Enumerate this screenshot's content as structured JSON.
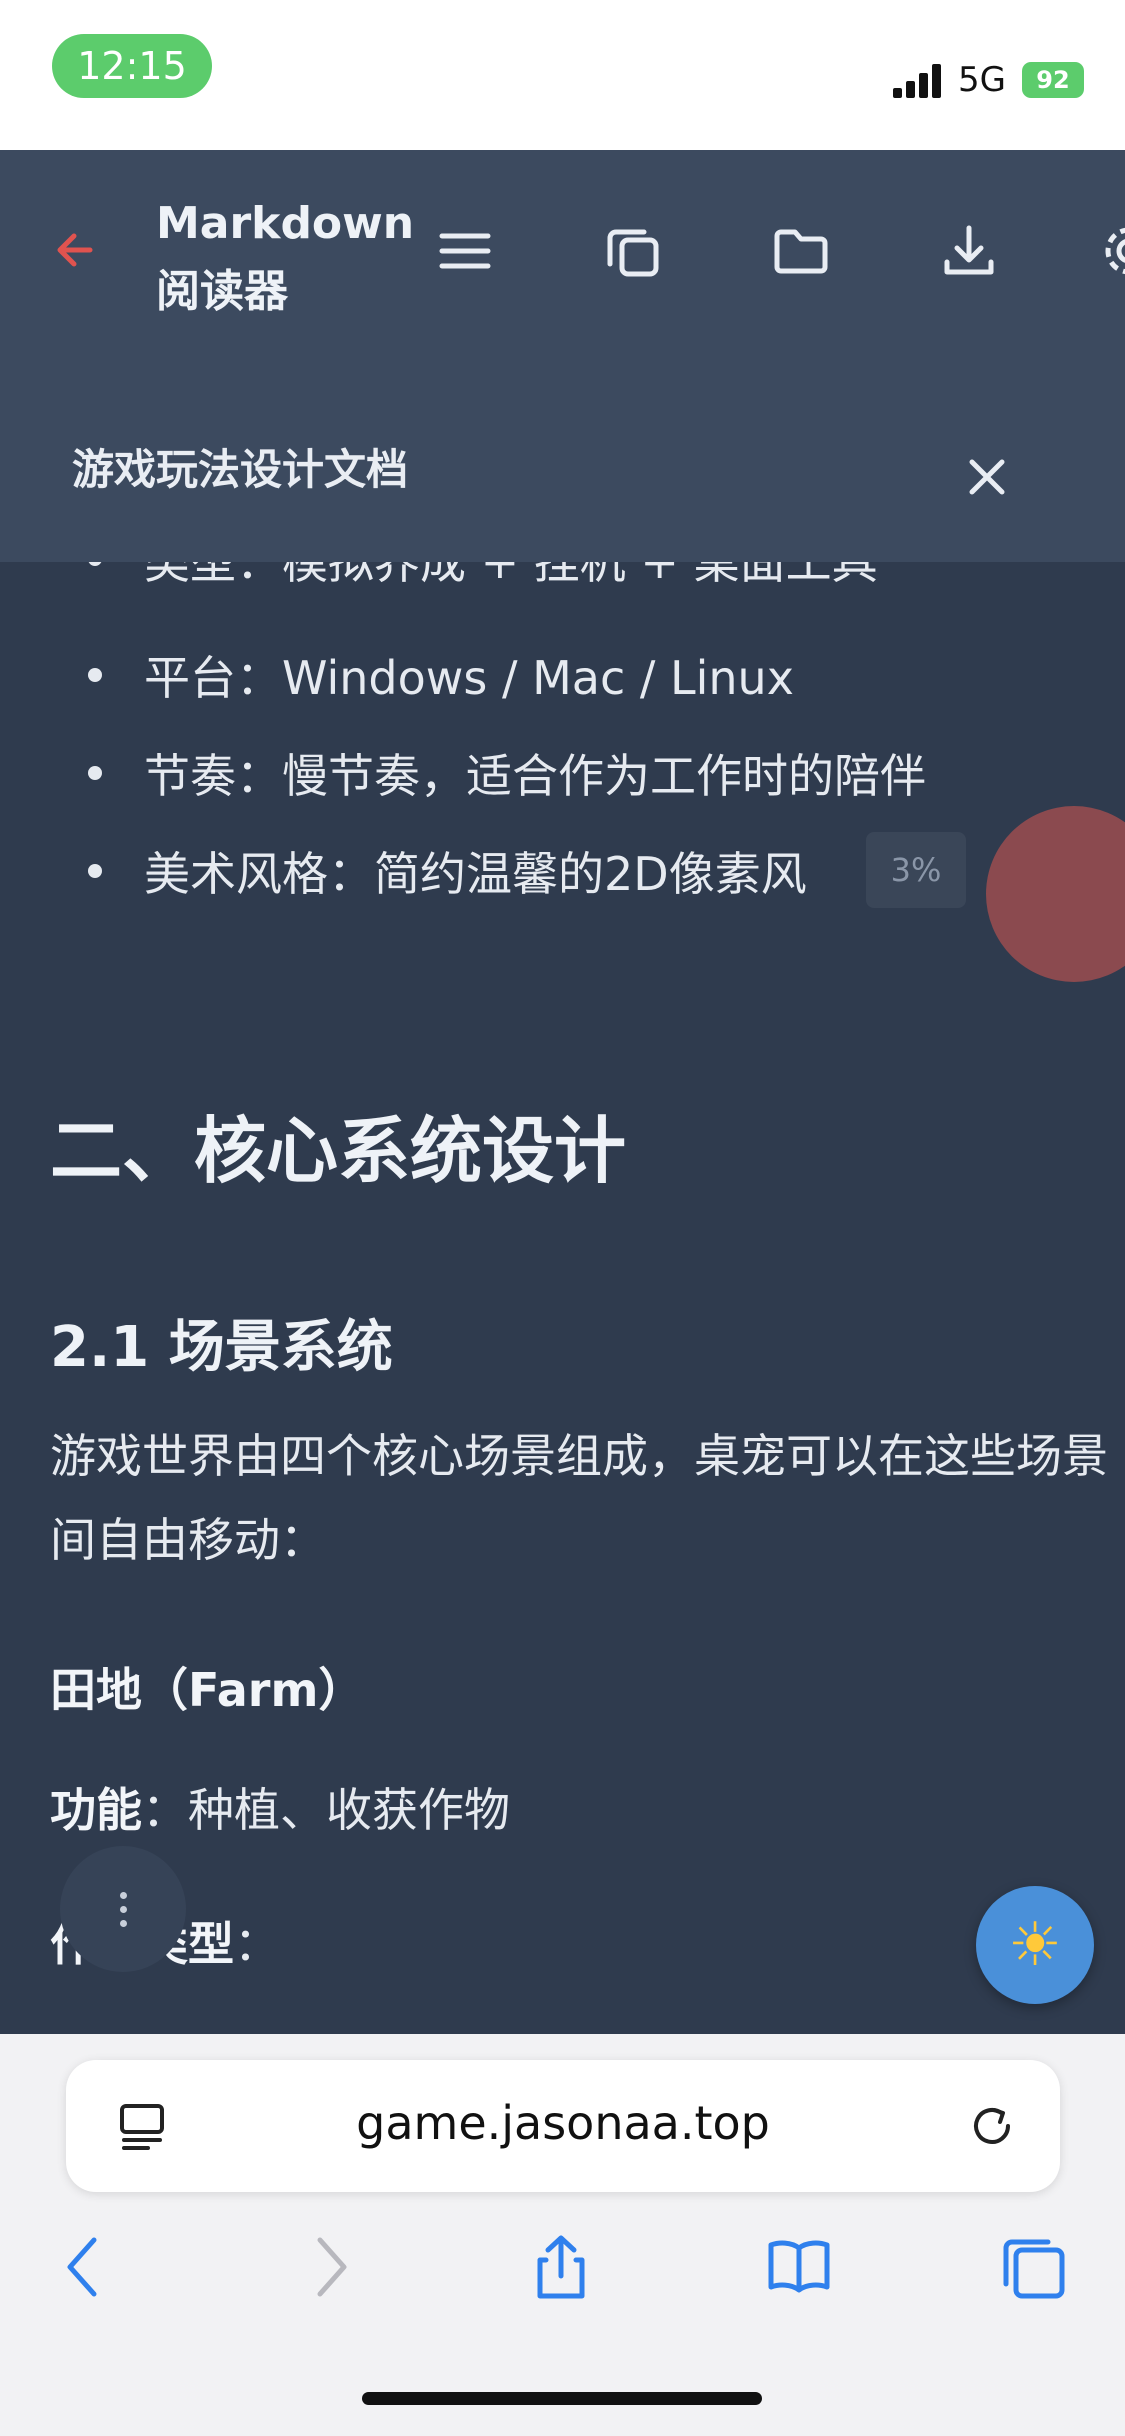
{
  "status_bar": {
    "time": "12:15",
    "network": "5G",
    "battery": "92"
  },
  "app": {
    "title": "Markdown 阅读器",
    "document_title": "游戏玩法设计文档",
    "icons": [
      "back-arrow-icon",
      "menu-icon",
      "copy-icon",
      "folder-icon",
      "download-icon",
      "settings-icon",
      "close-icon"
    ]
  },
  "content": {
    "cut_bullet": "类型：模拟养成 + 挂机 + 桌面工具",
    "bullets": [
      "平台：Windows / Mac / Linux",
      "节奏：慢节奏，适合作为工作时的陪伴",
      "美术风格：简约温馨的2D像素风"
    ],
    "progress_badge": "3%",
    "h2": "二、核心系统设计",
    "h3": "2.1 场景系统",
    "paragraph_lines": [
      "游戏世界由四个核心场景组成，桌宠可以在这些场景",
      "间自由移动："
    ],
    "farm_heading": "田地（Farm）",
    "function_label": "功能",
    "function_value": "：种植、收获作物",
    "crop_types_label": "作物类型",
    "crop_types_suffix": "："
  },
  "browser": {
    "url": "game.jasonaa.top",
    "icons": [
      "reader-icon",
      "reload-icon",
      "back-icon",
      "forward-icon",
      "share-icon",
      "bookmarks-icon",
      "tabs-icon"
    ]
  },
  "colors": {
    "accent_red": "#e0534f",
    "header_bg": "#3c4a5f",
    "content_bg": "#2f3b4e",
    "theme_button": "#4a90d9"
  }
}
